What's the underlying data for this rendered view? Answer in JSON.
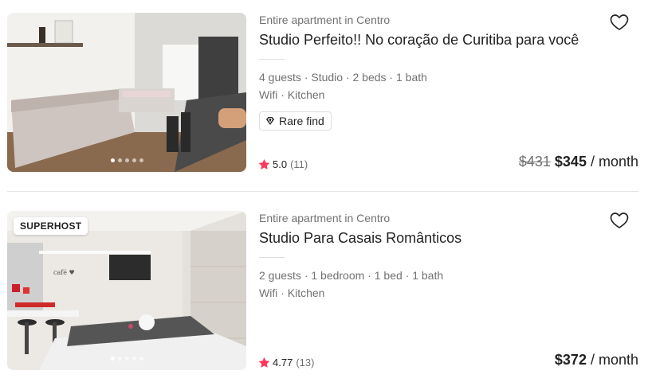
{
  "listings": [
    {
      "subtitle": "Entire apartment in Centro",
      "title": "Studio Perfeito!! No coração de Curitiba para você",
      "details": "4 guests · Studio · 2 beds · 1 bath",
      "amenities": "Wifi · Kitchen",
      "badge": "Rare find",
      "rating": "5.0",
      "reviews": "(11)",
      "old_price": "$431",
      "price": "$345",
      "unit": "/ month",
      "photo_count": 5,
      "active_photo": 1,
      "icons": {
        "favorite": "heart-outline-icon",
        "badge": "diamond-icon",
        "rating": "star-icon"
      }
    },
    {
      "superhost_label": "SUPERHOST",
      "subtitle": "Entire apartment in Centro",
      "title": "Studio Para Casais Românticos",
      "details": "2 guests · 1 bedroom · 1 bed · 1 bath",
      "amenities": "Wifi · Kitchen",
      "rating": "4.77",
      "reviews": "(13)",
      "price": "$372",
      "unit": "/ month",
      "photo_count": 5,
      "active_photo": 1,
      "icons": {
        "favorite": "heart-outline-icon",
        "rating": "star-icon"
      }
    }
  ],
  "colors": {
    "star": "#ff385c",
    "muted_text": "#717171",
    "primary_text": "#222222",
    "divider": "#dddddd"
  }
}
